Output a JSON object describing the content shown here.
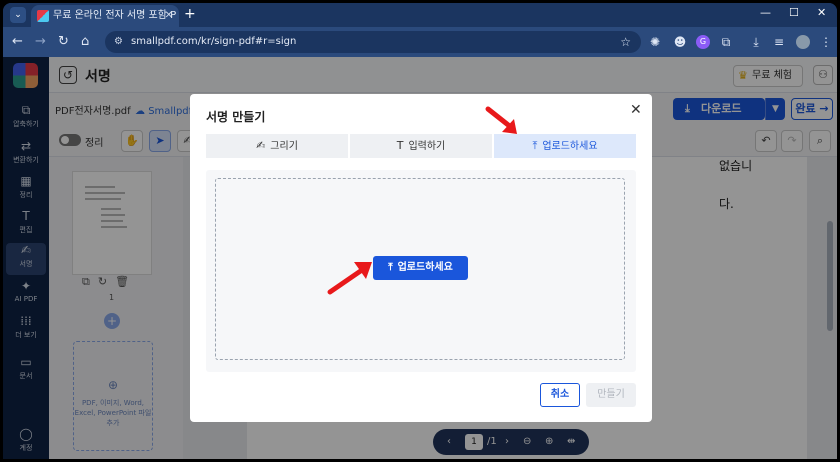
{
  "browser": {
    "tab_title": "무료 온라인 전자 서명 포함 P",
    "url": "smallpdf.com/kr/sign-pdf#r=sign"
  },
  "sidebar": {
    "items": [
      {
        "label": "압축하기",
        "icon": "compress-icon"
      },
      {
        "label": "변환하기",
        "icon": "convert-icon"
      },
      {
        "label": "정리",
        "icon": "organize-icon"
      },
      {
        "label": "편집",
        "icon": "edit-text-icon"
      },
      {
        "label": "서명",
        "icon": "signature-icon"
      },
      {
        "label": "AI PDF",
        "icon": "sparkle-icon"
      },
      {
        "label": "더 보기",
        "icon": "grid-icon"
      },
      {
        "label": "문서",
        "icon": "folder-icon"
      },
      {
        "label": "계정",
        "icon": "account-icon"
      }
    ]
  },
  "header": {
    "title": "서명",
    "free_trial": "무료 체험"
  },
  "file": {
    "name": "PDF전자서명.pdf",
    "cloud": "Smallpdf로"
  },
  "actions": {
    "download": "다운로드",
    "done": "완료 →"
  },
  "tools": {
    "toggle_label": "정리"
  },
  "thumbnails": {
    "page_number": "1",
    "drop_hint": "PDF, 이미지, Word, Excel, PowerPoint 파일 추가"
  },
  "document": {
    "line1": "없습니",
    "line2": "다."
  },
  "pager": {
    "current": "1",
    "total": "/1"
  },
  "modal": {
    "title": "서명 만들기",
    "tabs": [
      {
        "label": "그리기",
        "icon": "pen-draw-icon"
      },
      {
        "label": "입력하기",
        "icon": "text-t-icon"
      },
      {
        "label": "업로드하세요",
        "icon": "upload-icon"
      }
    ],
    "upload_button": "업로드하세요",
    "cancel": "취소",
    "create": "만들기"
  },
  "colors": {
    "accent": "#1a56db",
    "annotation_arrow": "#e8191b",
    "sidebar_bg": "#0f2346"
  }
}
